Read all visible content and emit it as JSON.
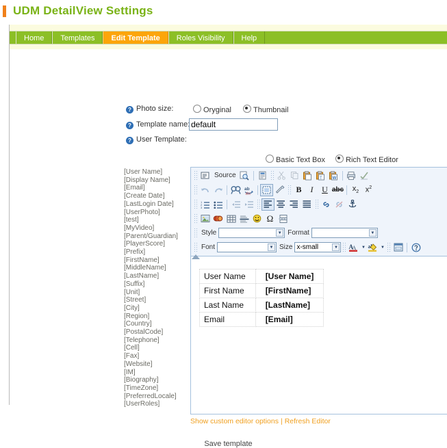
{
  "page": {
    "title": "UDM DetailView Settings",
    "accent_color": "#f0801a",
    "title_color": "#7ab317",
    "tabbar_color": "#8cbf26",
    "selected_tab_color": "#fca50a",
    "link_color": "#f0a020"
  },
  "tabs": [
    {
      "label": "Home",
      "selected": false
    },
    {
      "label": "Templates",
      "selected": false
    },
    {
      "label": "Edit Template",
      "selected": true
    },
    {
      "label": "Roles Visibility",
      "selected": false
    },
    {
      "label": "Help",
      "selected": false
    }
  ],
  "form": {
    "photo_size_label": "Photo size:",
    "photo_size_options": [
      {
        "label": "Oryginal",
        "selected": false
      },
      {
        "label": "Thumbnail",
        "selected": true
      }
    ],
    "template_name_label": "Template name:",
    "template_name_value": "default",
    "template_name_placeholder": "",
    "user_template_label": "User Template:",
    "editor_mode_options": [
      {
        "label": "Basic Text Box",
        "selected": false
      },
      {
        "label": "Rich Text Editor",
        "selected": true
      }
    ]
  },
  "tokens": [
    "[User Name]",
    "[Display Name]",
    "[Email]",
    "[Create Date]",
    "[LastLogin Date]",
    "[UserPhoto]",
    "[test]",
    "[MyVideo]",
    "[Parent/Guardian]",
    "[PlayerScore]",
    "[Prefix]",
    "[FirstName]",
    "[MiddleName]",
    "[LastName]",
    "[Suffix]",
    "[Unit]",
    "[Street]",
    "[City]",
    "[Region]",
    "[Country]",
    "[PostalCode]",
    "[Telephone]",
    "[Cell]",
    "[Fax]",
    "[Website]",
    "[IM]",
    "[Biography]",
    "[TimeZone]",
    "[PreferredLocale]",
    "[UserRoles]"
  ],
  "editor": {
    "source_label": "Source",
    "style_label": "Style",
    "style_value": "",
    "format_label": "Format",
    "format_value": "",
    "font_label": "Font",
    "font_value": "",
    "size_label": "Size",
    "size_value": "x-small",
    "table": {
      "rows": [
        {
          "label": "User Name",
          "token": "[User Name]"
        },
        {
          "label": "First Name",
          "token": "[FirstName]"
        },
        {
          "label": "Last Name",
          "token": "[LastName]"
        },
        {
          "label": "Email",
          "token": "[Email]"
        }
      ]
    }
  },
  "footer": {
    "show_options_link": "Show custom editor options",
    "separator": "|",
    "refresh_link": "Refresh Editor",
    "save_label": "Save template"
  }
}
